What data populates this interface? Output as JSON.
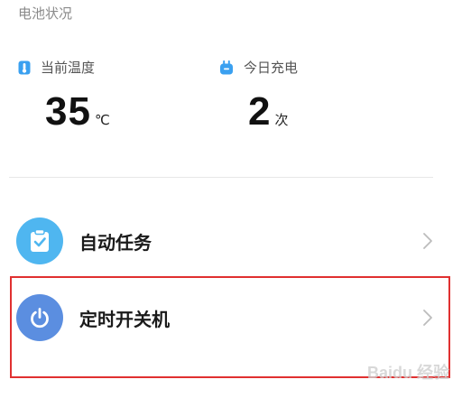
{
  "battery_section": {
    "title": "电池状况",
    "temperature": {
      "icon": "thermometer-icon",
      "label": "当前温度",
      "value": "35",
      "unit": "℃"
    },
    "charges_today": {
      "icon": "plug-icon",
      "label": "今日充电",
      "value": "2",
      "unit": "次"
    }
  },
  "menu": {
    "items": [
      {
        "label": "自动任务",
        "icon": "clipboard-check-icon",
        "color": "#4fb6f0"
      },
      {
        "label": "定时开关机",
        "icon": "power-icon",
        "color": "#5b8ee0"
      }
    ]
  },
  "colors": {
    "accent_blue": "#3aa0f0",
    "highlight_red": "#e03030"
  },
  "watermark": "Baidu 经验"
}
